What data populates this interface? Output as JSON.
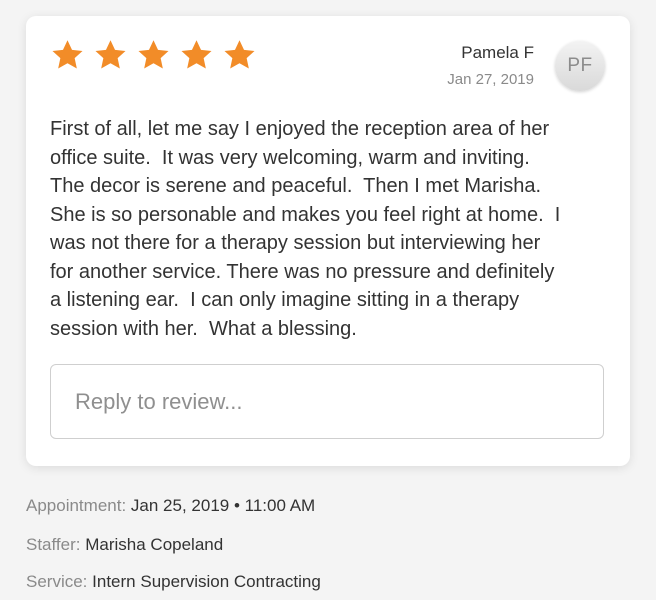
{
  "review": {
    "rating": 5,
    "max_rating": 5,
    "star_color": "#f28c28",
    "reviewer_name": "Pamela F",
    "date": "Jan 27, 2019",
    "avatar_initials": "PF",
    "text": "First of all, let me say I enjoyed the reception area of her\noffice suite.  It was very welcoming, warm and inviting.\nThe decor is serene and peaceful.  Then I met Marisha.\nShe is so personable and makes you feel right at home.  I\nwas not there for a therapy session but interviewing her\nfor another service. There was no pressure and definitely\na listening ear.  I can only imagine sitting in a therapy\nsession with her.  What a blessing.",
    "reply_placeholder": "Reply to review..."
  },
  "details": {
    "appointment_label": "Appointment:",
    "appointment_value": "Jan 25, 2019 • 11:00 AM",
    "staffer_label": "Staffer:",
    "staffer_value": "Marisha Copeland",
    "service_label": "Service:",
    "service_value": "Intern Supervision Contracting"
  }
}
